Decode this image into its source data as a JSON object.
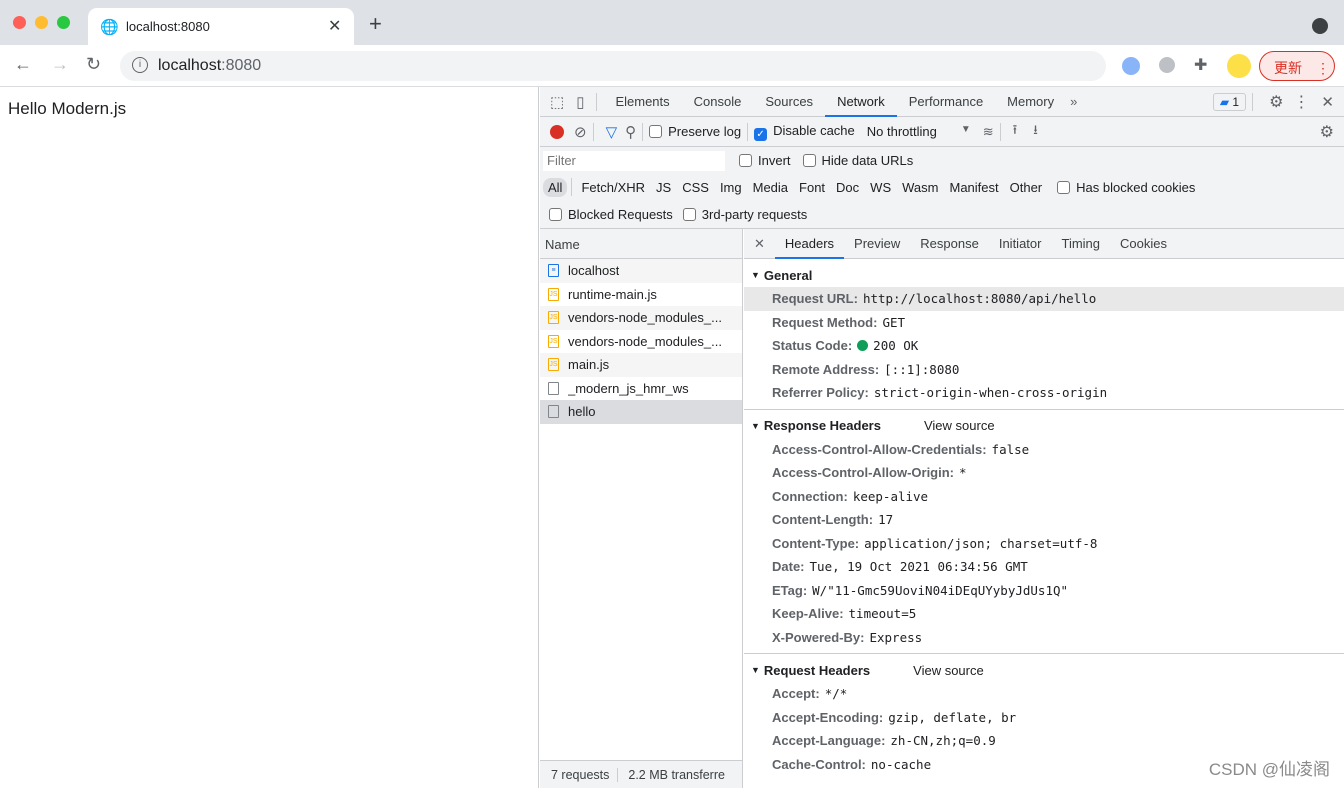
{
  "browser": {
    "tab_title": "localhost:8080",
    "url_host": "localhost",
    "url_port": ":8080",
    "update_label": "更新"
  },
  "page": {
    "text": "Hello Modern.js"
  },
  "devtools": {
    "tabs": [
      "Elements",
      "Console",
      "Sources",
      "Network",
      "Performance",
      "Memory"
    ],
    "active_tab": "Network",
    "issues_count": "1",
    "toolbar": {
      "preserve_log": "Preserve log",
      "disable_cache": "Disable cache",
      "throttling": "No throttling"
    },
    "filter": {
      "placeholder": "Filter",
      "invert": "Invert",
      "hide_data_urls": "Hide data URLs"
    },
    "types": [
      "All",
      "Fetch/XHR",
      "JS",
      "CSS",
      "Img",
      "Media",
      "Font",
      "Doc",
      "WS",
      "Wasm",
      "Manifest",
      "Other"
    ],
    "has_blocked_cookies": "Has blocked cookies",
    "blocked_requests": "Blocked Requests",
    "third_party": "3rd-party requests",
    "name_header": "Name",
    "requests": [
      {
        "name": "localhost",
        "type": "doc"
      },
      {
        "name": "runtime-main.js",
        "type": "js"
      },
      {
        "name": "vendors-node_modules_...",
        "type": "js"
      },
      {
        "name": "vendors-node_modules_...",
        "type": "js"
      },
      {
        "name": "main.js",
        "type": "js"
      },
      {
        "name": "_modern_js_hmr_ws",
        "type": "other"
      },
      {
        "name": "hello",
        "type": "other",
        "selected": true
      }
    ],
    "footer": {
      "requests": "7 requests",
      "transferred": "2.2 MB transferre"
    },
    "detail_tabs": [
      "Headers",
      "Preview",
      "Response",
      "Initiator",
      "Timing",
      "Cookies"
    ],
    "general": {
      "title": "General",
      "rows": [
        {
          "k": "Request URL:",
          "v": "http://localhost:8080/api/hello"
        },
        {
          "k": "Request Method:",
          "v": "GET"
        },
        {
          "k": "Status Code:",
          "v": "200 OK"
        },
        {
          "k": "Remote Address:",
          "v": "[::1]:8080"
        },
        {
          "k": "Referrer Policy:",
          "v": "strict-origin-when-cross-origin"
        }
      ]
    },
    "response_headers": {
      "title": "Response Headers",
      "view_source": "View source",
      "rows": [
        {
          "k": "Access-Control-Allow-Credentials:",
          "v": "false"
        },
        {
          "k": "Access-Control-Allow-Origin:",
          "v": "*"
        },
        {
          "k": "Connection:",
          "v": "keep-alive"
        },
        {
          "k": "Content-Length:",
          "v": "17"
        },
        {
          "k": "Content-Type:",
          "v": "application/json; charset=utf-8"
        },
        {
          "k": "Date:",
          "v": "Tue, 19 Oct 2021 06:34:56 GMT"
        },
        {
          "k": "ETag:",
          "v": "W/\"11-Gmc59UoviN04iDEqUYybyJdUs1Q\""
        },
        {
          "k": "Keep-Alive:",
          "v": "timeout=5"
        },
        {
          "k": "X-Powered-By:",
          "v": "Express"
        }
      ]
    },
    "request_headers": {
      "title": "Request Headers",
      "view_source": "View source",
      "rows": [
        {
          "k": "Accept:",
          "v": "*/*"
        },
        {
          "k": "Accept-Encoding:",
          "v": "gzip, deflate, br"
        },
        {
          "k": "Accept-Language:",
          "v": "zh-CN,zh;q=0.9"
        },
        {
          "k": "Cache-Control:",
          "v": "no-cache"
        }
      ]
    }
  },
  "watermark": "CSDN @仙凌阁",
  "colors": {
    "accent": "#1a73e8",
    "record": "#d93025",
    "status_ok": "#0f9d58"
  }
}
